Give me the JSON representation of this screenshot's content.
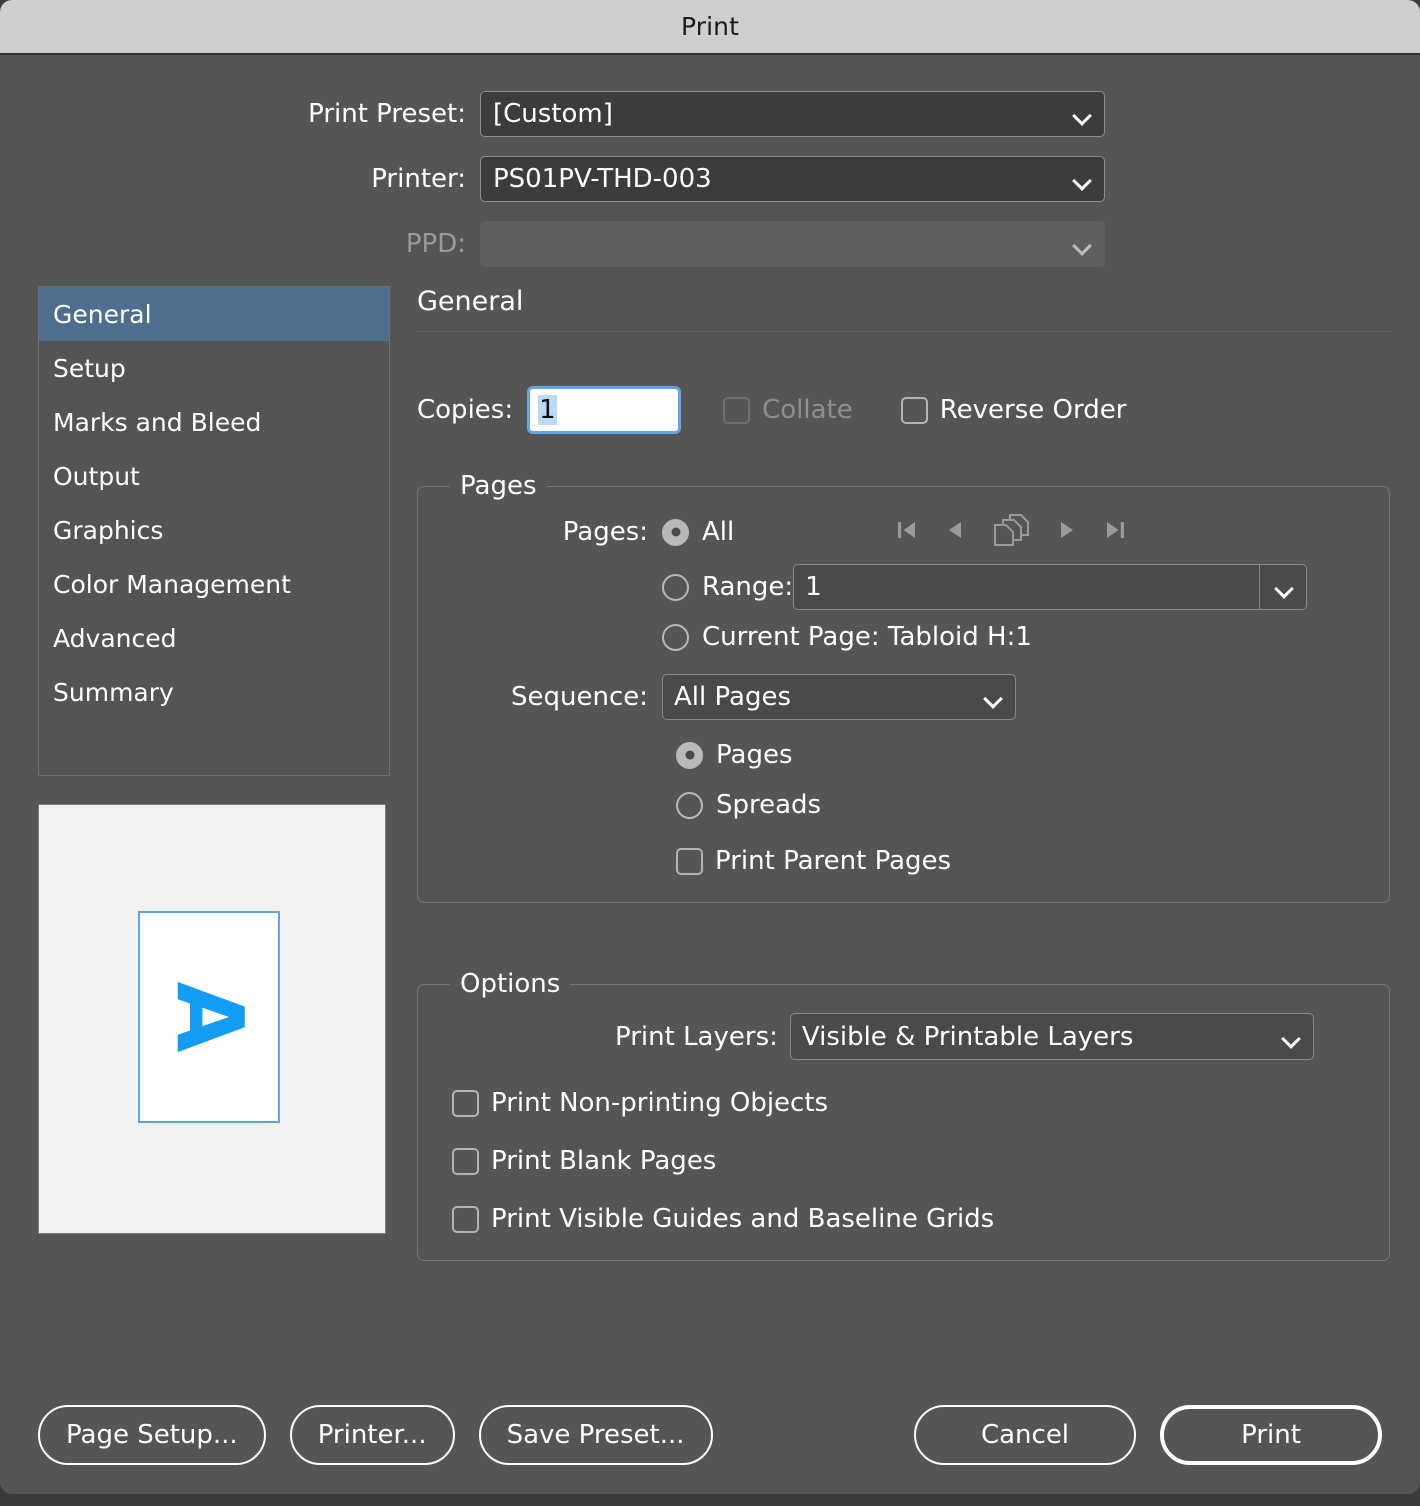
{
  "window": {
    "title": "Print"
  },
  "top_form": {
    "print_preset": {
      "label": "Print Preset:",
      "value": "[Custom]"
    },
    "printer": {
      "label": "Printer:",
      "value": "PS01PV-THD-003"
    },
    "ppd": {
      "label": "PPD:",
      "value": "",
      "disabled": true
    }
  },
  "sidebar": {
    "items": [
      {
        "label": "General",
        "selected": true
      },
      {
        "label": "Setup",
        "selected": false
      },
      {
        "label": "Marks and Bleed",
        "selected": false
      },
      {
        "label": "Output",
        "selected": false
      },
      {
        "label": "Graphics",
        "selected": false
      },
      {
        "label": "Color Management",
        "selected": false
      },
      {
        "label": "Advanced",
        "selected": false
      },
      {
        "label": "Summary",
        "selected": false
      }
    ]
  },
  "preview": {
    "glyph": "A",
    "glyph_color": "#139df4",
    "page_border_color": "#5aa6e8"
  },
  "panel": {
    "title": "General",
    "copies": {
      "label": "Copies:",
      "value": "1"
    },
    "collate": {
      "label": "Collate",
      "checked": false,
      "disabled": true
    },
    "reverse_order": {
      "label": "Reverse Order",
      "checked": false,
      "disabled": false
    },
    "pages_group": {
      "legend": "Pages",
      "pages_label": "Pages:",
      "all": {
        "label": "All",
        "selected": true
      },
      "range": {
        "label": "Range:",
        "value": "1",
        "selected": false
      },
      "current_page": {
        "label": "Current Page: Tabloid H:1",
        "selected": false
      },
      "page_nav_icons": [
        "first-page-icon",
        "previous-page-icon",
        "page-spread-icon",
        "next-page-icon",
        "last-page-icon"
      ],
      "sequence": {
        "label": "Sequence:",
        "value": "All Pages"
      },
      "pages_radio": {
        "label": "Pages",
        "selected": true
      },
      "spreads_radio": {
        "label": "Spreads",
        "selected": false
      },
      "print_parent_pages": {
        "label": "Print Parent Pages",
        "checked": false
      }
    },
    "options_group": {
      "legend": "Options",
      "print_layers": {
        "label": "Print Layers:",
        "value": "Visible & Printable Layers"
      },
      "print_nonprinting_objects": {
        "label": "Print Non-printing Objects",
        "checked": false
      },
      "print_blank_pages": {
        "label": "Print Blank Pages",
        "checked": false
      },
      "print_visible_guides": {
        "label": "Print Visible Guides and Baseline Grids",
        "checked": false
      }
    }
  },
  "footer": {
    "page_setup": "Page Setup...",
    "printer": "Printer...",
    "save_preset": "Save Preset...",
    "cancel": "Cancel",
    "print": "Print"
  },
  "colors": {
    "dialog_bg": "#555555",
    "titlebar_bg": "#cfcdd1",
    "selection_blue": "#4e6e90",
    "focus_blue": "#63a6e8",
    "field_bg": "#3c3c3c"
  }
}
